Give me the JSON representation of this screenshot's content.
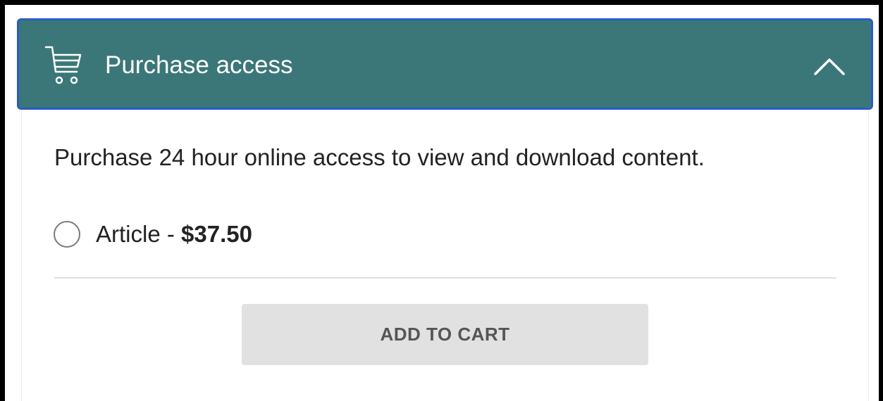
{
  "panel": {
    "title": "Purchase access",
    "header_icon": "cart-icon",
    "toggle_icon": "chevron-up-icon",
    "expanded": true,
    "header_color": "#3b7778",
    "focus_color": "#2a5bc8"
  },
  "description": "Purchase 24 hour online access to view and download content.",
  "options": [
    {
      "label": "Article - ",
      "price": "$37.50",
      "selected": false
    }
  ],
  "add_to_cart": {
    "label": "ADD TO CART",
    "disabled": true
  }
}
